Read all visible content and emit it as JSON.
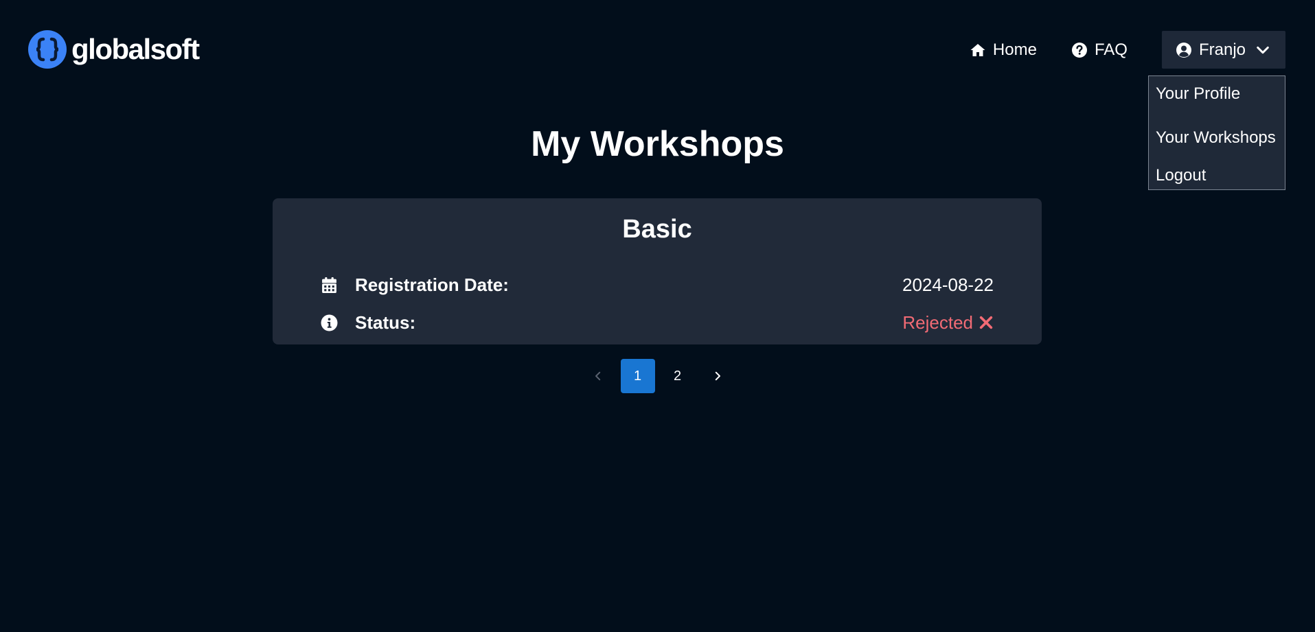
{
  "brand": {
    "name": "globalsoft",
    "accent": "#3b82f6"
  },
  "nav": {
    "home_label": "Home",
    "faq_label": "FAQ",
    "user_label": "Franjo"
  },
  "user_menu": {
    "items": [
      {
        "label": "Your Profile"
      },
      {
        "label": "Your Workshops"
      },
      {
        "label": "Logout"
      }
    ]
  },
  "page": {
    "title": "My Workshops"
  },
  "workshop": {
    "name": "Basic",
    "registration_label": "Registration Date:",
    "registration_value": "2024-08-22",
    "status_label": "Status:",
    "status_value": "Rejected",
    "status_color": "#f26b75"
  },
  "pagination": {
    "pages": [
      "1",
      "2"
    ],
    "current": "1"
  },
  "icons": {
    "home": "home-icon",
    "faq": "question-circle-icon",
    "user": "user-circle-icon",
    "dropdown": "chevron-down-icon",
    "calendar": "calendar-icon",
    "info": "info-circle-icon",
    "rejected": "close-icon",
    "prev": "chevron-left-icon",
    "next": "chevron-right-icon"
  }
}
